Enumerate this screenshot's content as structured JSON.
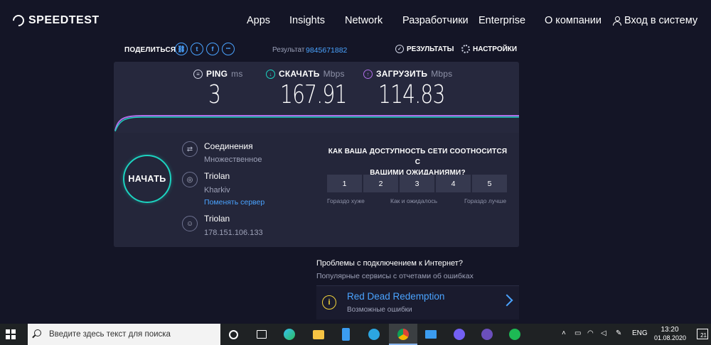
{
  "header": {
    "logo_text": "SPEEDTEST",
    "nav": [
      {
        "label": "Apps"
      },
      {
        "label": "Insights"
      },
      {
        "label": "Network"
      },
      {
        "label": "Разработчики"
      },
      {
        "label": "Enterprise"
      },
      {
        "label": "О компании"
      }
    ],
    "login_label": "Вход в систему"
  },
  "share": {
    "label": "ПОДЕЛИТЬСЯ",
    "buttons": [
      {
        "icon": "link-icon",
        "glyph": "⛓"
      },
      {
        "icon": "twitter-icon",
        "glyph": "t"
      },
      {
        "icon": "facebook-icon",
        "glyph": "f"
      },
      {
        "icon": "more-icon",
        "glyph": "•••"
      }
    ],
    "result_label": "Результат",
    "result_id": "9845671882",
    "results_link": "РЕЗУЛЬТАТЫ",
    "settings_link": "НАСТРОЙКИ"
  },
  "metrics": {
    "ping": {
      "label": "PING",
      "unit": "ms",
      "value": "3"
    },
    "download": {
      "label": "СКАЧАТЬ",
      "unit": "Mbps",
      "value": "167.91"
    },
    "upload": {
      "label": "ЗАГРУЗИТЬ",
      "unit": "Mbps",
      "value": "114.83"
    }
  },
  "test": {
    "start_label": "НАЧАТЬ",
    "connections_title": "Соединения",
    "connections_value": "Множественное",
    "server_name": "Triolan",
    "server_city": "Kharkiv",
    "change_server": "Поменять сервер",
    "provider_name": "Triolan",
    "provider_ip": "178.151.106.133"
  },
  "survey": {
    "question_line1": "КАК ВАША ДОСТУПНОСТЬ СЕТИ СООТНОСИТСЯ С",
    "question_line2": "ВАШИМИ ОЖИДАНИЯМИ?",
    "ratings": [
      "1",
      "2",
      "3",
      "4",
      "5"
    ],
    "label_worse": "Гораздо хуже",
    "label_expected": "Как и ожидалось",
    "label_better": "Гораздо лучше"
  },
  "problems": {
    "title": "Проблемы с подключением к Интернет?",
    "subtitle": "Популярные сервисы с отчетами об ошибках",
    "game_name": "Red Dead Redemption",
    "game_sub": "Возможные ошибки"
  },
  "taskbar": {
    "search_placeholder": "Введите здесь текст для поиска",
    "lang": "ENG",
    "time": "13:20",
    "date": "01.08.2020",
    "notifications": "21"
  },
  "colors": {
    "accent_cyan": "#1cd3c0",
    "accent_blue": "#4aa3ff",
    "accent_purple": "#b06ee8",
    "panel_bg": "#26283d",
    "page_bg": "#141526"
  }
}
